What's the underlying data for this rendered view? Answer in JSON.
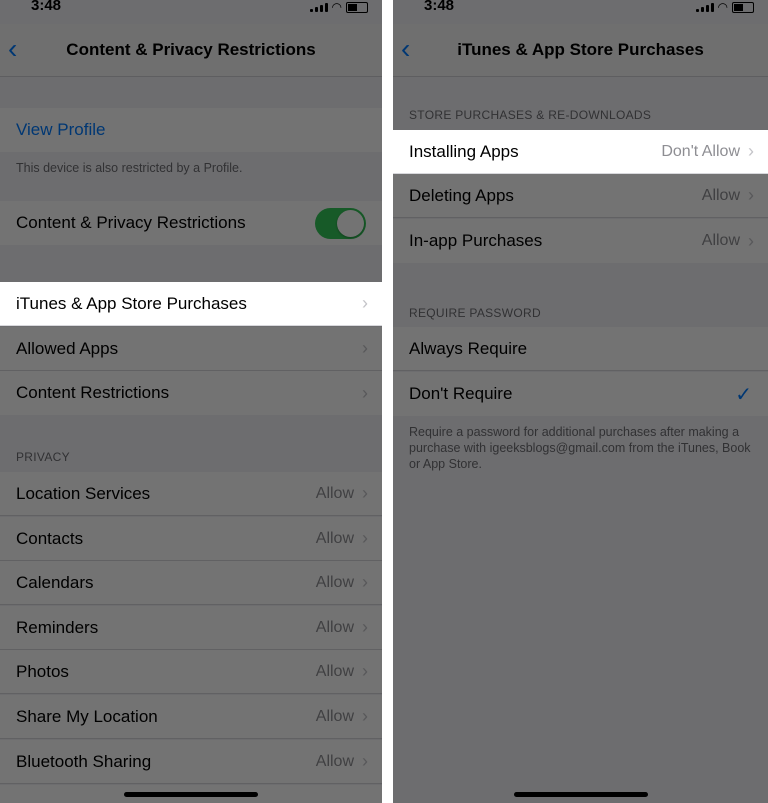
{
  "left": {
    "status_time": "3:48",
    "nav": {
      "back_icon": "chevron-left-icon",
      "title": "Content & Privacy Restrictions"
    },
    "view_profile": "View Profile",
    "profile_note": "This device is also restricted by a Profile.",
    "restrictions_toggle": {
      "label": "Content & Privacy Restrictions",
      "state": "on",
      "color": "#34c759"
    },
    "store_group": [
      {
        "label": "iTunes & App Store Purchases"
      },
      {
        "label": "Allowed Apps"
      },
      {
        "label": "Content Restrictions"
      }
    ],
    "privacy_header": "PRIVACY",
    "privacy_items": [
      {
        "label": "Location Services",
        "value": "Allow"
      },
      {
        "label": "Contacts",
        "value": "Allow"
      },
      {
        "label": "Calendars",
        "value": "Allow"
      },
      {
        "label": "Reminders",
        "value": "Allow"
      },
      {
        "label": "Photos",
        "value": "Allow"
      },
      {
        "label": "Share My Location",
        "value": "Allow"
      },
      {
        "label": "Bluetooth Sharing",
        "value": "Allow"
      }
    ]
  },
  "right": {
    "status_time": "3:48",
    "nav": {
      "back_icon": "chevron-left-icon",
      "title": "iTunes & App Store Purchases"
    },
    "store_header": "STORE PURCHASES & RE-DOWNLOADS",
    "store_items": [
      {
        "label": "Installing Apps",
        "value": "Don't Allow"
      },
      {
        "label": "Deleting Apps",
        "value": "Allow"
      },
      {
        "label": "In-app Purchases",
        "value": "Allow"
      }
    ],
    "password_header": "REQUIRE PASSWORD",
    "password_items": [
      {
        "label": "Always Require"
      },
      {
        "label": "Don't Require"
      }
    ],
    "password_note": "Require a password for additional purchases after making a purchase with igeeksblogs@gmail.com from the iTunes, Book or App Store."
  },
  "colors": {
    "accent": "#007aff",
    "toggle_on": "#34c759",
    "overlay": "rgba(0,0,0,0.55)"
  }
}
